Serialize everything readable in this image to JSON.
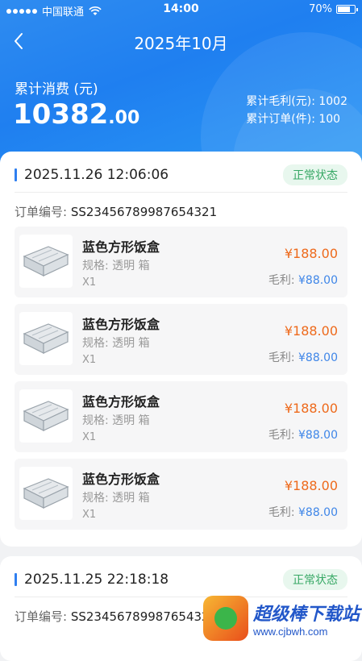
{
  "status_bar": {
    "carrier": "中国联通",
    "time": "14:00",
    "battery": "70%"
  },
  "nav": {
    "title": "2025年10月"
  },
  "summary": {
    "label": "累计消费 (元)",
    "amount_int": "10382",
    "amount_dec": ".00",
    "gross_profit_label": "累计毛利(元):",
    "gross_profit": "1002",
    "orders_label": "累计订单(件):",
    "orders": "100"
  },
  "orders": [
    {
      "datetime": "2025.11.26 12:06:06",
      "status": "正常状态",
      "order_no_label": "订单编号:",
      "order_no": "SS23456789987654321",
      "items": [
        {
          "name": "蓝色方形饭盒",
          "spec": "规格:  透明 箱",
          "qty": "X1",
          "price": "¥188.00",
          "profit_label": "毛利:",
          "profit": "¥88.00"
        },
        {
          "name": "蓝色方形饭盒",
          "spec": "规格:  透明 箱",
          "qty": "X1",
          "price": "¥188.00",
          "profit_label": "毛利:",
          "profit": "¥88.00"
        },
        {
          "name": "蓝色方形饭盒",
          "spec": "规格:  透明 箱",
          "qty": "X1",
          "price": "¥188.00",
          "profit_label": "毛利:",
          "profit": "¥88.00"
        },
        {
          "name": "蓝色方形饭盒",
          "spec": "规格:  透明 箱",
          "qty": "X1",
          "price": "¥188.00",
          "profit_label": "毛利:",
          "profit": "¥88.00"
        }
      ]
    },
    {
      "datetime": "2025.11.25 22:18:18",
      "status": "正常状态",
      "order_no_label": "订单编号:",
      "order_no": "SS23456789987654321"
    }
  ],
  "watermark": {
    "name": "超级棒下载站",
    "url": "www.cjbwh.com"
  },
  "icons": {
    "back": "chevron-left-icon",
    "wifi": "wifi-icon",
    "battery": "battery-icon",
    "product": "lunch-box-icon"
  },
  "colors": {
    "primary": "#1f7ff0",
    "price": "#ee6a1c",
    "profit": "#3f86e8",
    "status_bg": "#e8f7ee",
    "status_text": "#37a865"
  }
}
